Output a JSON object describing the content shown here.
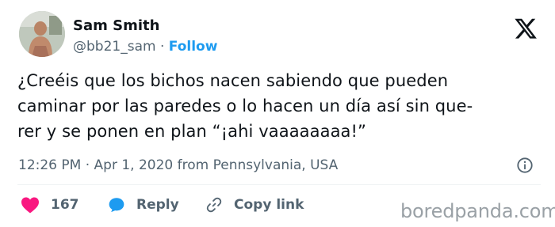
{
  "user": {
    "name": "Sam Smith",
    "handle": "@bb21_sam",
    "separator": "·",
    "follow_label": "Follow"
  },
  "tweet": {
    "lines": [
      "¿Creéis que los bichos nacen sabiendo que pueden",
      "caminar por las paredes o lo hacen un día así sin que-",
      "rer y se ponen en plan “¡ahi vaaaaaaaa!”"
    ]
  },
  "meta": {
    "text": "12:26 PM · Apr 1, 2020 from Pennsylvania, USA"
  },
  "actions": {
    "likes": "167",
    "reply_label": "Reply",
    "copy_link_label": "Copy link"
  },
  "icons": {
    "logo": "x-logo-icon",
    "info": "info-icon",
    "heart": "heart-icon",
    "reply": "reply-icon",
    "link": "link-icon"
  },
  "colors": {
    "text": "#0f1419",
    "secondary": "#536471",
    "accent": "#1d9bf0",
    "heart": "#f91880",
    "watermark": "#9aa1a6"
  },
  "watermark": "boredpanda.com"
}
